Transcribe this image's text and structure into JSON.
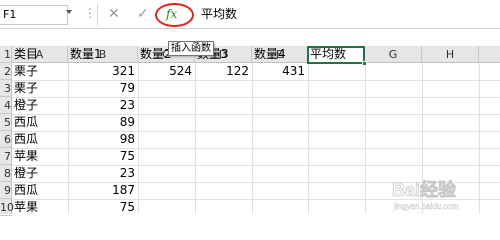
{
  "formula_bar": {
    "name_box": "F1",
    "formula": "平均数",
    "fx_label": "fx",
    "tooltip": "插入函数",
    "cancel_symbol": "✕",
    "enter_symbol": "✓",
    "dots": "⋮"
  },
  "columns": [
    "A",
    "B",
    "C",
    "D",
    "E",
    "F",
    "G",
    "H"
  ],
  "rows": [
    "1",
    "2",
    "3",
    "4",
    "5",
    "6",
    "7",
    "8",
    "9",
    "10"
  ],
  "cells": {
    "A1": "类目",
    "B1": "数量1",
    "C1": "数量2",
    "D1": "数量3",
    "E1": "数量4",
    "F1": "平均数",
    "A2": "栗子",
    "B2": "321",
    "C2": "524",
    "D2": "122",
    "E2": "431",
    "A3": "栗子",
    "B3": "79",
    "A4": "橙子",
    "B4": "23",
    "A5": "西瓜",
    "B5": "89",
    "A6": "西瓜",
    "B6": "98",
    "A7": "苹果",
    "B7": "75",
    "A8": "橙子",
    "B8": "23",
    "A9": "西瓜",
    "B9": "187",
    "A10": "苹果",
    "B10": "75"
  },
  "watermark": "Bai经验 jingyan.baidu.com",
  "colors": {
    "accent": "#217346",
    "highlight_ring": "#e0221b",
    "fx_green": "#2e7d32"
  }
}
